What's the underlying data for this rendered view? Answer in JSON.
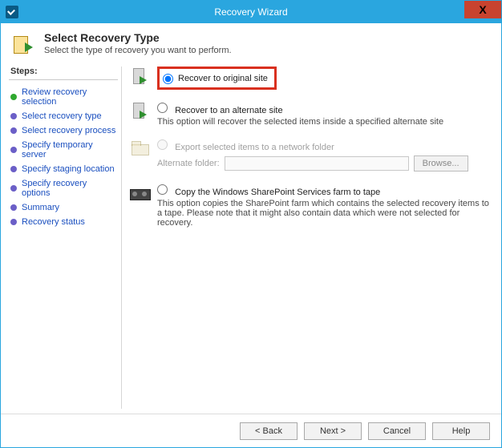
{
  "window": {
    "title": "Recovery Wizard"
  },
  "header": {
    "title": "Select Recovery Type",
    "subtitle": "Select the type of recovery you want to perform."
  },
  "steps": {
    "title": "Steps:",
    "items": [
      {
        "label": "Review recovery selection",
        "state": "done"
      },
      {
        "label": "Select recovery type",
        "state": "current"
      },
      {
        "label": "Select recovery process",
        "state": "todo"
      },
      {
        "label": "Specify temporary server",
        "state": "todo"
      },
      {
        "label": "Specify staging location",
        "state": "todo"
      },
      {
        "label": "Specify recovery options",
        "state": "todo"
      },
      {
        "label": "Summary",
        "state": "todo"
      },
      {
        "label": "Recovery status",
        "state": "todo"
      }
    ]
  },
  "options": {
    "selected": "original",
    "original": {
      "label": "Recover to original site"
    },
    "alternate": {
      "label": "Recover to an alternate site",
      "desc": "This option will recover the selected items inside a specified alternate site"
    },
    "export": {
      "label": "Export selected items to a network folder",
      "folder_label": "Alternate folder:",
      "folder_value": "",
      "browse": "Browse...",
      "enabled": false
    },
    "tape": {
      "label": "Copy the Windows SharePoint Services farm to tape",
      "desc": "This option copies the SharePoint farm which contains the selected recovery items to a tape. Please note that it might also contain data which were not selected for recovery."
    }
  },
  "buttons": {
    "back": "< Back",
    "next": "Next >",
    "cancel": "Cancel",
    "help": "Help"
  }
}
